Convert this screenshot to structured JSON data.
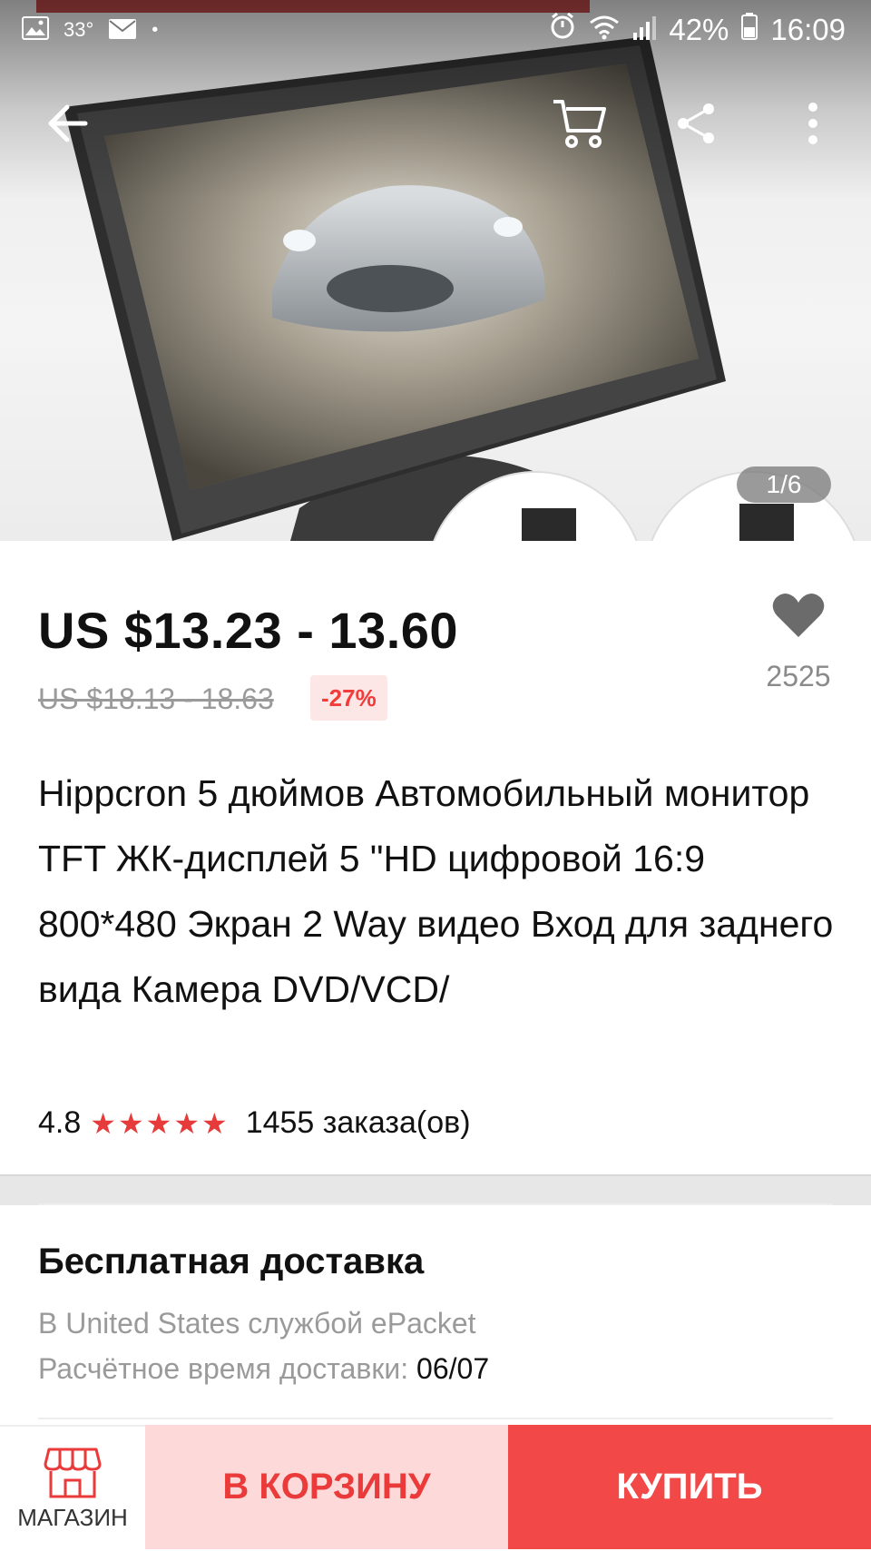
{
  "status_bar": {
    "temperature": "33°",
    "battery": "42%",
    "time": "16:09"
  },
  "hero": {
    "image_counter": "1/6"
  },
  "product": {
    "price": "US $13.23 - 13.60",
    "old_price": "US $18.13 - 18.63",
    "discount": "-27%",
    "wishlist_count": "2525",
    "title": "Hippcron 5 дюймов Автомобильный монитор TFT ЖК-дисплей 5 \"HD цифровой 16:9 800*480 Экран 2 Way видео Вход для заднего вида Камера DVD/VCD/",
    "rating": "4.8",
    "stars": "★★★★★",
    "orders": "1455 заказа(ов)"
  },
  "shipping": {
    "title": "Бесплатная доставка",
    "method": "В United States службой ePacket",
    "eta_label": "Расчётное время доставки:",
    "eta_value": "06/07"
  },
  "bottom_bar": {
    "store_label": "МАГАЗИН",
    "cart_label": "В КОРЗИНУ",
    "buy_label": "КУПИТЬ"
  },
  "colors": {
    "accent": "#f24848",
    "cart_bg": "#fdd9d9",
    "discount_bg": "#fde6e6",
    "star": "#e73a3a"
  }
}
